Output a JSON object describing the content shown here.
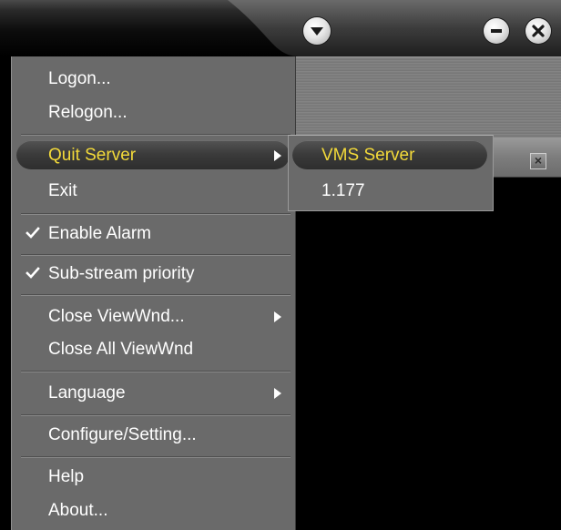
{
  "titlebar": {
    "icons": [
      "chevron-down-icon",
      "minimize-icon",
      "close-icon"
    ]
  },
  "menu": {
    "logon": "Logon...",
    "relogon": "Relogon...",
    "quit_server": "Quit Server",
    "exit": "Exit",
    "enable_alarm": "Enable Alarm",
    "sub_stream_priority": "Sub-stream priority",
    "close_viewwnd": "Close ViewWnd...",
    "close_all_viewwnd": "Close All ViewWnd",
    "language": "Language",
    "configure_setting": "Configure/Setting...",
    "help": "Help",
    "about": "About..."
  },
  "menu_state": {
    "highlighted": "Quit Server",
    "checked": [
      "Enable Alarm",
      "Sub-stream priority"
    ]
  },
  "submenu": {
    "items": [
      "VMS Server",
      "1.177"
    ],
    "highlighted": "VMS Server"
  },
  "pane": {
    "close_glyph": "×"
  },
  "colors": {
    "highlight_text": "#f2d93a",
    "menu_bg": "#6a6a6a",
    "menu_text": "#ffffff"
  }
}
